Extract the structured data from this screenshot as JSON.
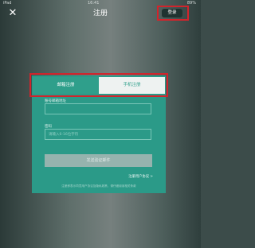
{
  "status_bar": {
    "left": "iPad",
    "time": "16:41",
    "right": "89%"
  },
  "header": {
    "close_icon": "close-icon",
    "title": "注册",
    "login_label": "登录"
  },
  "tabs": [
    {
      "label": "邮箱注册",
      "selected": false
    },
    {
      "label": "手机注册",
      "selected": true
    }
  ],
  "form": {
    "phone_label": "账号邮箱地址",
    "phone_placeholder": "",
    "password_label": "密码",
    "password_placeholder": "请输入6-16位字符",
    "submit_label": "发送验证邮件",
    "terms_link": "注册用户协议 >",
    "footer_note": "注册即表示同意用户协议及隐私政策，请仔细阅读相关条款"
  },
  "colors": {
    "accent": "#2b9a88",
    "highlight": "#d1242c",
    "header_button": "#1f3330"
  }
}
